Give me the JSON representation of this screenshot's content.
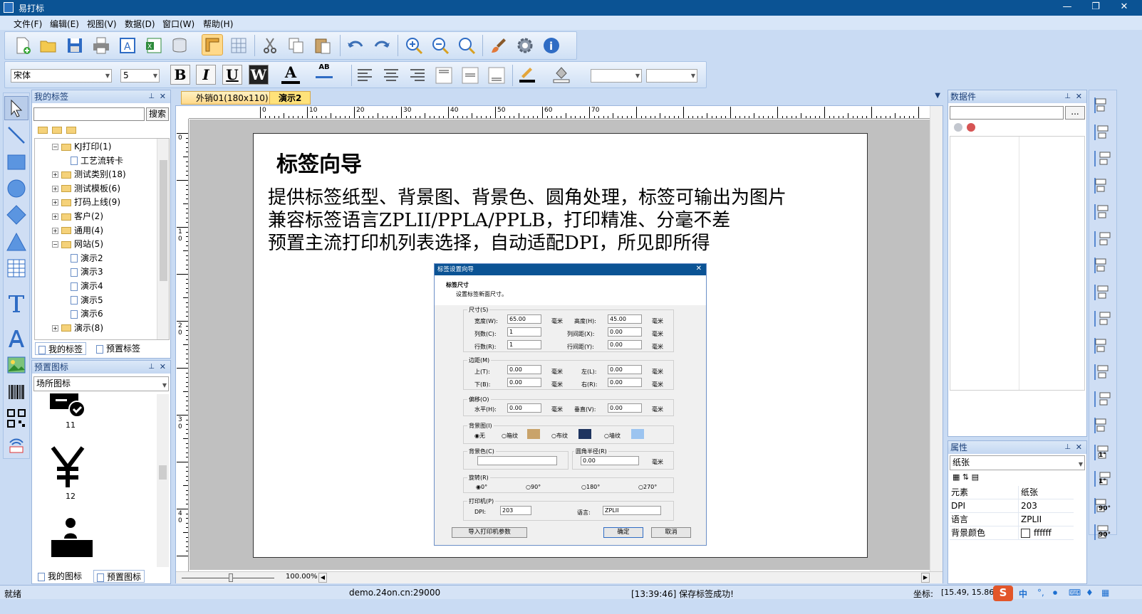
{
  "window": {
    "title": "易打标",
    "min": "—",
    "max": "❐",
    "close": "✕"
  },
  "menu": [
    "文件(F)",
    "编辑(E)",
    "视图(V)",
    "数据(D)",
    "窗口(W)",
    "帮助(H)"
  ],
  "format_bar": {
    "font": "宋体",
    "size": "5",
    "bold": "B",
    "italic": "I",
    "underline": "U",
    "wrap": "W",
    "font_color": "A",
    "spell": "AB"
  },
  "left_panel": {
    "title": "我的标签",
    "search_button": "搜索",
    "search_value": "",
    "tree": [
      {
        "label": "KJ打印(1)",
        "level": 1,
        "type": "folder",
        "expanded": true
      },
      {
        "label": "工艺流转卡",
        "level": 2,
        "type": "doc"
      },
      {
        "label": "测试类别(18)",
        "level": 1,
        "type": "folder"
      },
      {
        "label": "测试模板(6)",
        "level": 1,
        "type": "folder"
      },
      {
        "label": "打码上线(9)",
        "level": 1,
        "type": "folder"
      },
      {
        "label": "客户(2)",
        "level": 1,
        "type": "folder"
      },
      {
        "label": "通用(4)",
        "level": 1,
        "type": "folder"
      },
      {
        "label": "网站(5)",
        "level": 1,
        "type": "folder",
        "expanded": true
      },
      {
        "label": "演示2",
        "level": 2,
        "type": "doc"
      },
      {
        "label": "演示3",
        "level": 2,
        "type": "doc"
      },
      {
        "label": "演示4",
        "level": 2,
        "type": "doc"
      },
      {
        "label": "演示5",
        "level": 2,
        "type": "doc"
      },
      {
        "label": "演示6",
        "level": 2,
        "type": "doc"
      },
      {
        "label": "演示(8)",
        "level": 1,
        "type": "folder"
      }
    ],
    "tabs": [
      "我的标签",
      "预置标签"
    ]
  },
  "icon_panel": {
    "title": "预置图标",
    "category": "场所图标",
    "items": [
      "11",
      "12"
    ],
    "tabs": [
      "我的图标",
      "预置图标"
    ]
  },
  "doc_tabs": [
    "外销01(180x110)",
    "演示2"
  ],
  "ruler_labels": [
    "0",
    "10",
    "20",
    "30",
    "40",
    "50",
    "60",
    "70"
  ],
  "vruler_labels": [
    "0",
    "1\n0",
    "2\n0",
    "3\n0",
    "4\n0"
  ],
  "label": {
    "heading": "标签向导",
    "lines": [
      "提供标签纸型、背景图、背景色、圆角处理，标签可输出为图片",
      "兼容标签语言ZPLII/PPLA/PPLB，打印精准、分毫不差",
      "预置主流打印机列表选择，自动适配DPI，所见即所得"
    ]
  },
  "dialog": {
    "title": "标签设置向导",
    "section": "标签尺寸",
    "subtitle": "设置标签新面尺寸。",
    "size_group": "尺寸(S)",
    "width_label": "宽度(W):",
    "width": "65.00",
    "height_label": "高度(H):",
    "height": "45.00",
    "cols_label": "列数(C):",
    "cols": "1",
    "colgap_label": "列间距(X):",
    "colgap": "0.00",
    "rows_label": "行数(R):",
    "rows": "1",
    "rowgap_label": "行间距(Y):",
    "rowgap": "0.00",
    "unit": "毫米",
    "margin_group": "边距(M)",
    "top_label": "上(T):",
    "top": "0.00",
    "left_label": "左(L):",
    "left": "0.00",
    "bottom_label": "下(B):",
    "bottom": "0.00",
    "right_label": "右(R):",
    "right": "0.00",
    "offset_group": "偏移(O)",
    "h_label": "水平(H):",
    "h": "0.00",
    "v_label": "垂直(V):",
    "v": "0.00",
    "bg_group": "背景图(I)",
    "bg_options": [
      "无",
      "箱纹",
      "布纹",
      "墙纹"
    ],
    "bgcolor_group": "背景色(C)",
    "radius_group": "圆角半径(R)",
    "radius": "0.00",
    "rotate_group": "旋转(R)",
    "rotate_options": [
      "0°",
      "90°",
      "180°",
      "270°"
    ],
    "printer_group": "打印机(P)",
    "dpi_label": "DPI:",
    "dpi": "203",
    "lang_label": "语言:",
    "lang": "ZPLII",
    "import_button": "导入打印机参数",
    "ok_button": "确定",
    "cancel_button": "取消"
  },
  "zoom": "100.00%",
  "data_panel": {
    "title": "数据件",
    "browse": "..."
  },
  "prop_panel": {
    "title": "属性",
    "object": "纸张",
    "rows": [
      {
        "k": "元素",
        "v": "纸张"
      },
      {
        "k": "DPI",
        "v": "203"
      },
      {
        "k": "语言",
        "v": "ZPLII"
      },
      {
        "k": "背景颜色",
        "v": "ffffff"
      }
    ]
  },
  "status": {
    "ready": "就绪",
    "server": "demo.24on.cn:29000",
    "message": "[13:39:46] 保存标签成功!",
    "coord_label": "坐标:",
    "coord": "[15.49, 15.86]",
    "ime": "中"
  }
}
